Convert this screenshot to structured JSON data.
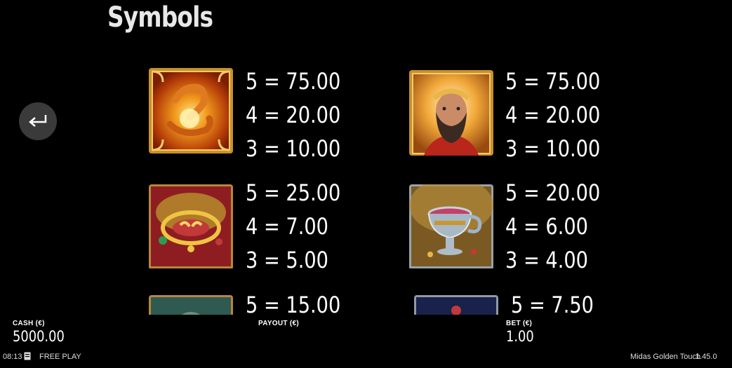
{
  "page": {
    "title": "Symbols"
  },
  "symbols": [
    {
      "name": "golden-hand",
      "pays": [
        "5 = 75.00",
        "4 = 20.00",
        "3 = 10.00"
      ]
    },
    {
      "name": "king-midas",
      "pays": [
        "5 = 75.00",
        "4 = 20.00",
        "3 = 10.00"
      ]
    },
    {
      "name": "necklace",
      "pays": [
        "5 = 25.00",
        "4 = 7.00",
        "3 = 5.00"
      ]
    },
    {
      "name": "chalice",
      "pays": [
        "5 = 20.00",
        "4 = 6.00",
        "3 = 4.00"
      ]
    },
    {
      "name": "teal-symbol",
      "pays": [
        "5 = 15.00"
      ]
    },
    {
      "name": "blue-symbol",
      "pays": [
        "5 = 7.50"
      ]
    }
  ],
  "footer": {
    "cash_label": "CASH (€)",
    "cash_value": "5000.00",
    "payout_label": "PAYOUT (€)",
    "bet_label": "BET (€)",
    "bet_value": "1.00"
  },
  "status": {
    "time": "08:13",
    "mode": "FREE PLAY",
    "game_name": "Midas Golden Touch",
    "version": "1.45.0"
  },
  "icons": {
    "back": "return-arrow-icon",
    "history": "history-icon"
  },
  "colors": {
    "background": "#000000",
    "gold": "#d9a536",
    "text": "#ffffff"
  }
}
